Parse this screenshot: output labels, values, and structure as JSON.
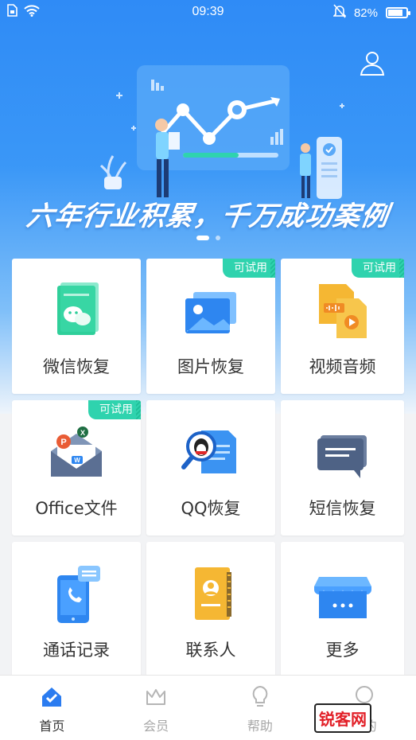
{
  "status_bar": {
    "time": "09:39",
    "battery": "82%",
    "battery_level": 0.82
  },
  "banner": {
    "slogan": "六年行业积累，千万成功案例",
    "slides": 2,
    "active_slide": 1
  },
  "features": [
    {
      "label": "微信恢复",
      "icon": "wechat-doc-icon",
      "trial": ""
    },
    {
      "label": "图片恢复",
      "icon": "photo-icon",
      "trial": "可试用"
    },
    {
      "label": "视频音频",
      "icon": "media-files-icon",
      "trial": "可试用"
    },
    {
      "label": "Office文件",
      "icon": "office-mail-icon",
      "trial": "可试用"
    },
    {
      "label": "QQ恢复",
      "icon": "qq-search-icon",
      "trial": ""
    },
    {
      "label": "短信恢复",
      "icon": "sms-icon",
      "trial": ""
    },
    {
      "label": "通话记录",
      "icon": "call-log-icon",
      "trial": ""
    },
    {
      "label": "联系人",
      "icon": "contacts-icon",
      "trial": ""
    },
    {
      "label": "更多",
      "icon": "store-more-icon",
      "trial": ""
    }
  ],
  "tabs": [
    {
      "label": "首页",
      "icon": "home-icon",
      "active": true
    },
    {
      "label": "会员",
      "icon": "crown-icon",
      "active": false
    },
    {
      "label": "帮助",
      "icon": "bulb-icon",
      "active": false
    },
    {
      "label": "我的",
      "icon": "user-icon",
      "active": false
    }
  ],
  "watermark": {
    "brand": "锐客网"
  },
  "colors": {
    "primary_blue": "#2f8bf6",
    "trial_green": "#2fd3ae",
    "tab_active": "#2b7cf0"
  }
}
